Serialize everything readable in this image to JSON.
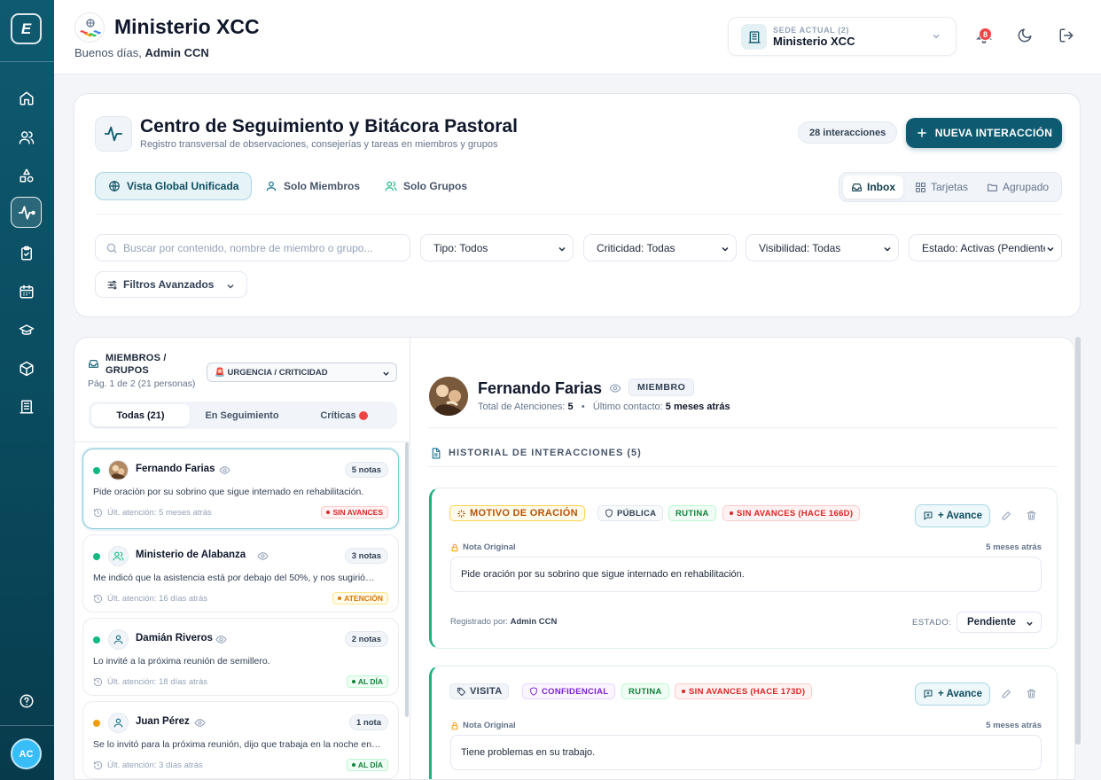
{
  "app": {
    "logo_letter": "E"
  },
  "header": {
    "org_name": "Ministerio XCC",
    "greeting_prefix": "Buenos días,",
    "greeting_user": "Admin CCN",
    "sede_label": "SEDE ACTUAL (2)",
    "sede_value": "Ministerio XCC",
    "notification_count": "8"
  },
  "user": {
    "initials": "AC"
  },
  "page": {
    "title": "Centro de Seguimiento y Bitácora Pastoral",
    "subtitle": "Registro transversal de observaciones, consejerías y tareas en miembros y grupos",
    "interactions_count": "28 interacciones",
    "new_button": "NUEVA INTERACCIÓN",
    "scope_tabs": [
      "Vista Global Unificada",
      "Solo Miembros",
      "Solo Grupos"
    ],
    "view_options": [
      "Inbox",
      "Tarjetas",
      "Agrupado"
    ],
    "search_placeholder": "Buscar por contenido, nombre de miembro o grupo...",
    "filters": {
      "tipo": "Tipo: Todos",
      "criticidad": "Criticidad: Todas",
      "visibilidad": "Visibilidad: Todas",
      "estado": "Estado: Activas (Pendientes"
    },
    "advanced_filters": "Filtros Avanzados"
  },
  "list": {
    "title_line1": "MIEMBROS /",
    "title_line2": "GRUPOS",
    "pagination": "Pág. 1 de 2 (21 personas)",
    "sort": "🚨 URGENCIA / CRITICIDAD",
    "segments": [
      "Todas (21)",
      "En Seguimiento",
      "Críticas"
    ],
    "items": [
      {
        "name": "Fernando Farias",
        "notes": "5 notas",
        "text": "Pide oración por su sobrino que sigue internado en rehabilitación.",
        "last": "Últ. atención: 5 meses atrás",
        "badge": "SIN AVANCES",
        "status_color": "#10b981"
      },
      {
        "name": "Ministerio de Alabanza",
        "notes": "3 notas",
        "text": "Me indicó que la asistencia está por debajo del 50%, y nos sugirió…",
        "last": "Últ. atención: 16 días atrás",
        "badge": "ATENCIÓN",
        "status_color": "#10b981"
      },
      {
        "name": "Damián Riveros",
        "notes": "2 notas",
        "text": "Lo invité a la próxima reunión de semillero.",
        "last": "Últ. atención: 18 días atrás",
        "badge": "AL DÍA",
        "status_color": "#10b981"
      },
      {
        "name": "Juan Pérez",
        "notes": "1 nota",
        "text": "Se lo invitó para la próxima reunión, dijo que trabaja en la noche en…",
        "last": "Últ. atención: 3 días atrás",
        "badge": "AL DÍA",
        "status_color": "#f59e0b"
      }
    ]
  },
  "detail": {
    "name": "Fernando Farias",
    "type": "MIEMBRO",
    "total_label": "Total de Atenciones:",
    "total_value": "5",
    "last_label": "Último contacto:",
    "last_value": "5 meses atrás",
    "history_title": "HISTORIAL DE INTERACCIONES (5)",
    "interactions": [
      {
        "category": "MOTIVO DE ORACIÓN",
        "visibility": "PÚBLICA",
        "level": "RUTINA",
        "status": "SIN AVANCES (HACE 166D)",
        "avance": "+ Avance",
        "note_label": "Nota Original",
        "note_time": "5 meses atrás",
        "note": "Pide oración por su sobrino que sigue internado en rehabilitación.",
        "registered_label": "Registrado por:",
        "registered_by": "Admin CCN",
        "estado_label": "ESTADO:",
        "estado": "Pendiente"
      },
      {
        "category": "VISITA",
        "visibility": "CONFIDENCIAL",
        "level": "RUTINA",
        "status": "SIN AVANCES (HACE 173D)",
        "avance": "+ Avance",
        "note_label": "Nota Original",
        "note_time": "5 meses atrás",
        "note": "Tiene problemas en su trabajo."
      }
    ]
  },
  "colors": {
    "primary": "#0e5a70",
    "sidebar": "#0a4a5e",
    "success": "#22b07d",
    "danger": "#ef4444",
    "warning": "#f59e0b"
  }
}
